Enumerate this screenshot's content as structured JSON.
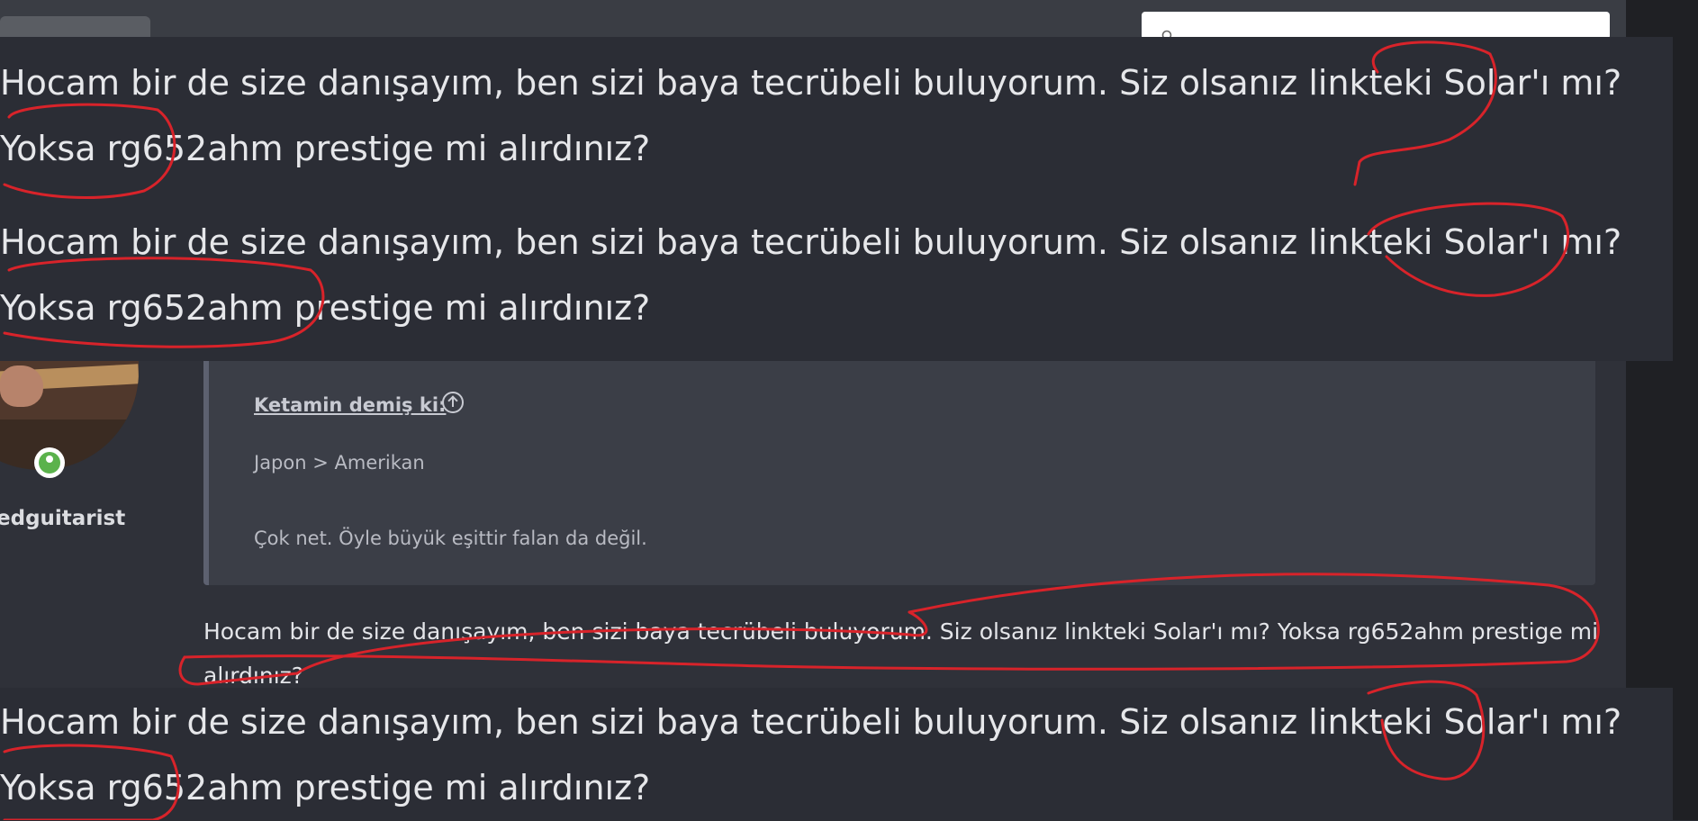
{
  "forum": {
    "username": "edguitarist",
    "quote": {
      "author_label": "Ketamin demiş ki:",
      "lines": [
        "Japon > Amerikan",
        "Çok net. Öyle büyük eşittir falan da değil."
      ]
    },
    "reply_text": "Hocam bir de size danışayım, ben sizi baya tecrübeli buluyorum. Siz olsanız linkteki Solar'ı mı? Yoksa rg652ahm prestige mi alırdınız?"
  },
  "zoomed_overlays": [
    {
      "text": "Hocam bir de size danışayım, ben sizi baya tecrübeli buluyorum. Siz olsanız linkteki Solar'ı mı? Yoksa rg652ahm prestige mi alırdınız?"
    },
    {
      "text": "Hocam bir de size danışayım, ben sizi baya tecrübeli buluyorum. Siz olsanız linkteki Solar'ı mı? Yoksa rg652ahm prestige mi alırdınız?"
    },
    {
      "text": "Hocam bir de size danışayım, ben sizi baya tecrübeli buluyorum. Siz olsanız linkteki Solar'ı mı? Yoksa rg652ahm prestige mi alırdınız?"
    }
  ],
  "icons": {
    "search": "search-icon",
    "quote_jump": "arrow-up-circle-icon",
    "online_status": "user-online-icon"
  },
  "colors": {
    "background": "#2b2d33",
    "annotation": "#d8232a",
    "online": "#5bb24c"
  }
}
